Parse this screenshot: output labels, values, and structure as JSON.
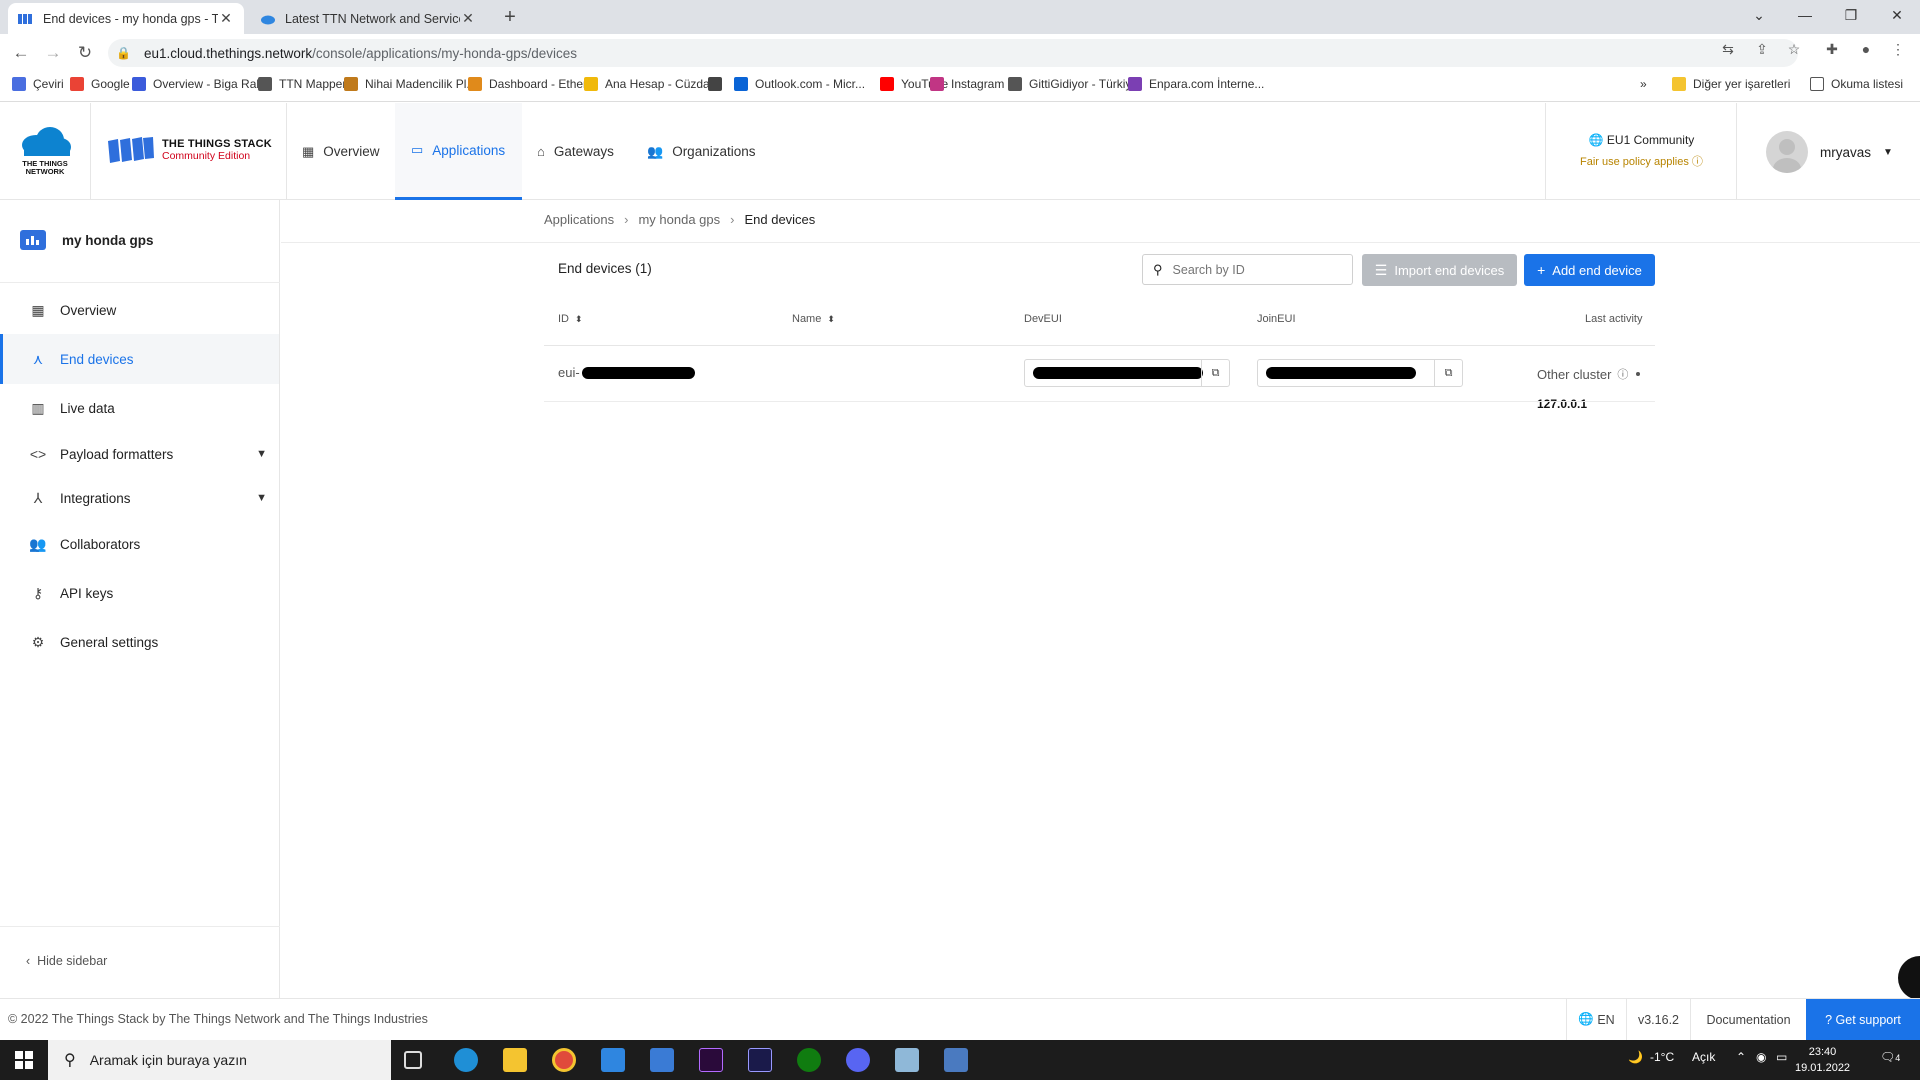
{
  "browser": {
    "tabs": [
      {
        "title": "End devices - my honda gps - The Things Stack",
        "close": "✕"
      },
      {
        "title": "Latest TTN Network and Services status",
        "close": "✕"
      }
    ],
    "new_tab": "+",
    "url_host": "eu1.cloud.thethings.network",
    "url_path": "/console/applications/my-honda-gps/devices",
    "bookmarks": [
      {
        "label": "Çeviri",
        "color": "#4a6ee0"
      },
      {
        "label": "Google",
        "color": "#ea4335"
      },
      {
        "label": "Overview - Biga Rak...",
        "color": "#3b5bdb"
      },
      {
        "label": "TTN Mapper",
        "color": "#555555"
      },
      {
        "label": "Nihai Madencilik Pl...",
        "color": "#c07a1b"
      },
      {
        "label": "Dashboard - Ether...",
        "color": "#e08a1b"
      },
      {
        "label": "Ana Hesap - Cüzda...",
        "color": "#f0b90b"
      },
      {
        "label": "",
        "color": "#444444"
      },
      {
        "label": "Outlook.com - Micr...",
        "color": "#0a64d6"
      },
      {
        "label": "YouTube",
        "color": "#ff0000"
      },
      {
        "label": "Instagram",
        "color": "#c13584"
      },
      {
        "label": "GittiGidiyor - Türkiy...",
        "color": "#555555"
      },
      {
        "label": "Enpara.com İnterne...",
        "color": "#7b3fb3"
      }
    ],
    "bookmarks_more": "»",
    "other_bookmarks": "Diğer yer işaretleri",
    "reading_list": "Okuma listesi"
  },
  "header": {
    "ttn_logo_text": "THE THINGS NETWORK",
    "stack_title": "THE THINGS STACK",
    "stack_edition": "Community Edition",
    "nav": [
      {
        "label": "Overview",
        "icon": "grid-icon"
      },
      {
        "label": "Applications",
        "icon": "application-icon",
        "active": true
      },
      {
        "label": "Gateways",
        "icon": "gateway-icon"
      },
      {
        "label": "Organizations",
        "icon": "organization-icon"
      }
    ],
    "cluster_name": "EU1 Community",
    "cluster_note": "Fair use policy applies",
    "username": "mryavas"
  },
  "sidebar": {
    "app_name": "my honda gps",
    "items": [
      {
        "label": "Overview",
        "icon": "grid-icon"
      },
      {
        "label": "End devices",
        "icon": "device-icon",
        "active": true
      },
      {
        "label": "Live data",
        "icon": "chart-icon"
      },
      {
        "label": "Payload formatters",
        "icon": "code-icon",
        "expandable": true
      },
      {
        "label": "Integrations",
        "icon": "integration-icon",
        "expandable": true
      },
      {
        "label": "Collaborators",
        "icon": "people-icon"
      },
      {
        "label": "API keys",
        "icon": "key-icon"
      },
      {
        "label": "General settings",
        "icon": "gear-icon"
      }
    ],
    "hide_label": "Hide sidebar"
  },
  "main": {
    "breadcrumb": [
      "Applications",
      "my honda gps",
      "End devices"
    ],
    "title": "End devices (1)",
    "search_placeholder": "Search by ID",
    "import_button": "Import end devices",
    "add_button": "Add end device",
    "columns": [
      "ID",
      "Name",
      "DevEUI",
      "JoinEUI",
      "Last activity"
    ],
    "rows": [
      {
        "id": "eui-",
        "name": "",
        "last_activity": "Other cluster",
        "address": "127.0.0.1"
      }
    ]
  },
  "footer": {
    "copyright": "© 2022 The Things Stack by The Things Network and The Things Industries",
    "language": "EN",
    "version": "v3.16.2",
    "documentation": "Documentation",
    "support": "Get support"
  },
  "taskbar": {
    "search_placeholder": "Aramak için buraya yazın",
    "weather": "-1°C",
    "weather_status": "Açık",
    "time": "23:40",
    "date": "19.01.2022",
    "notifications": "4"
  }
}
